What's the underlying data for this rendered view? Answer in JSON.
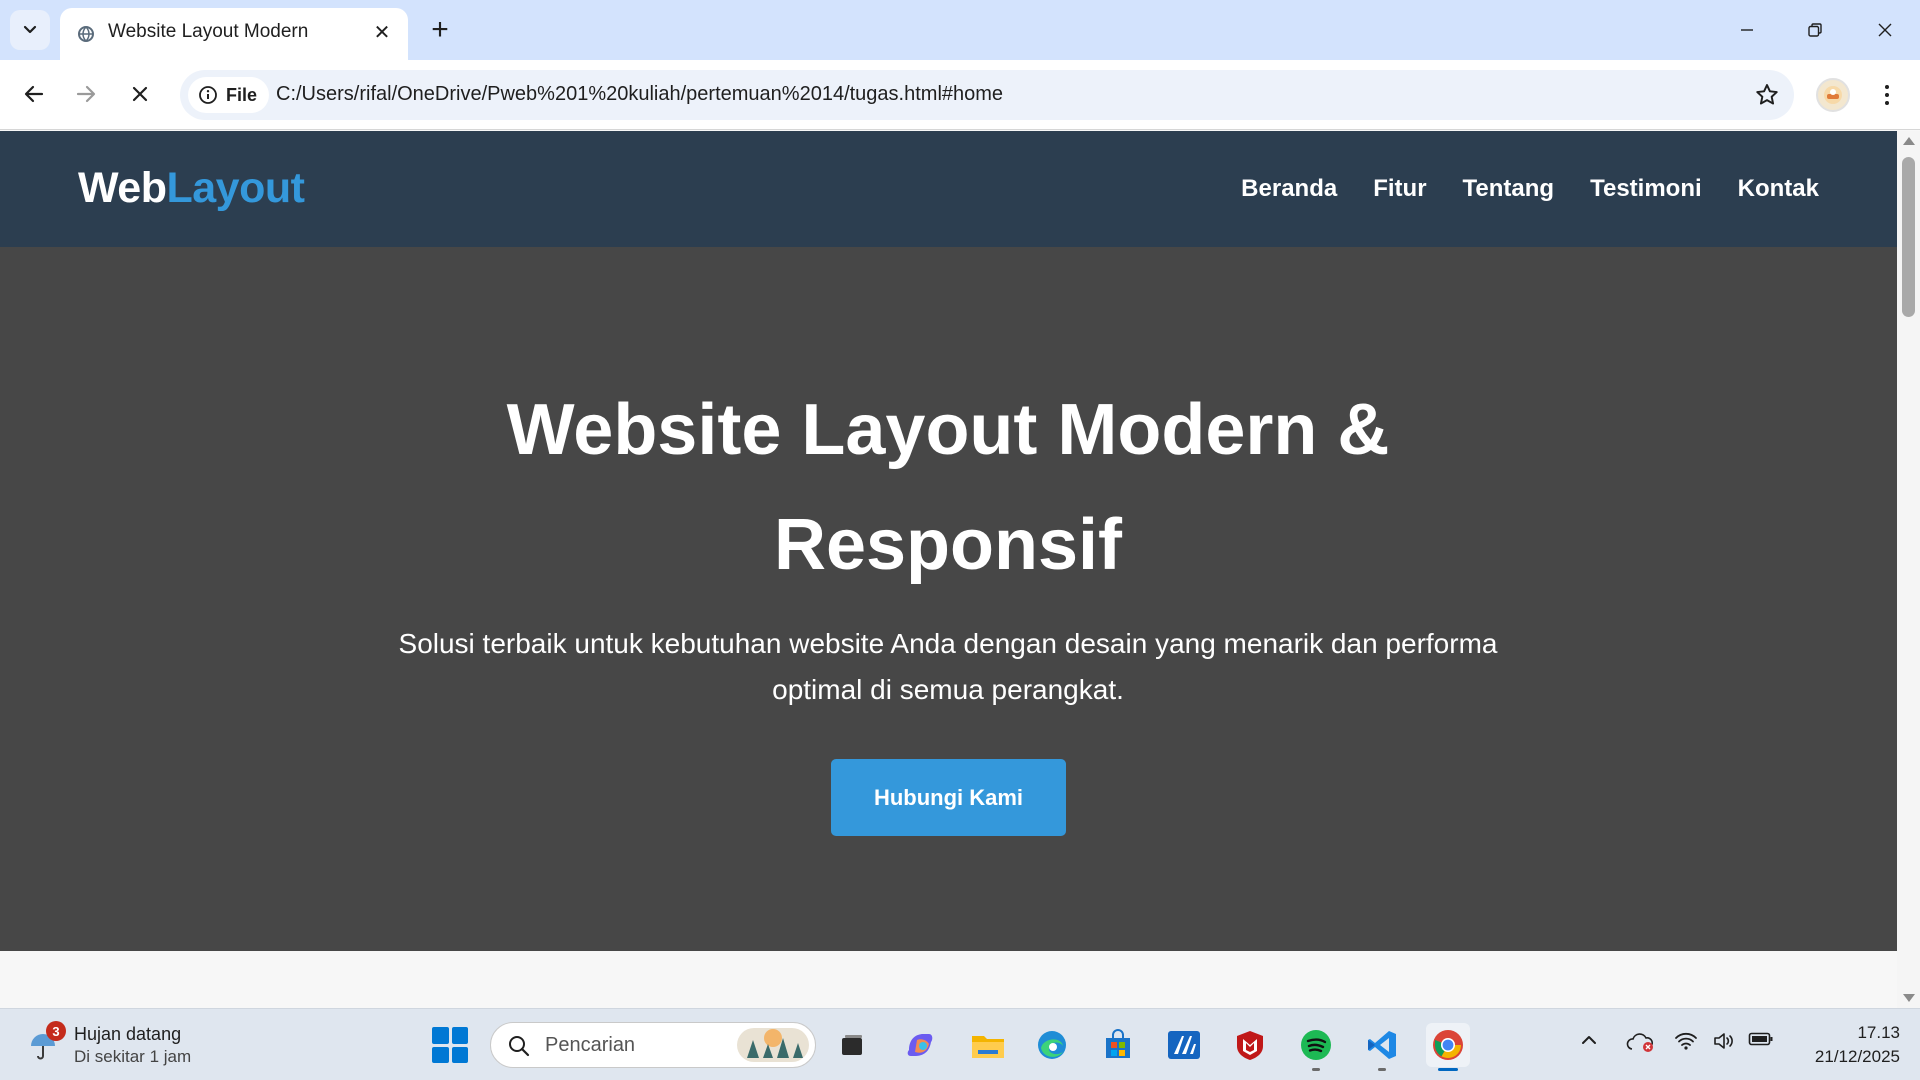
{
  "browser": {
    "tab_title": "Website Layout Modern",
    "new_tab_symbol": "+",
    "close_symbol": "✕",
    "file_chip_label": "File",
    "url": "C:/Users/rifal/OneDrive/Pweb%201%20kuliah/pertemuan%2014/tugas.html#home",
    "icons": [
      "tab-search-icon",
      "globe-icon",
      "back-icon",
      "forward-icon",
      "stop-loading-icon",
      "info-icon",
      "star-icon",
      "profile-avatar",
      "menu-icon",
      "minimize-icon",
      "restore-icon",
      "window-close-icon"
    ]
  },
  "site": {
    "logo_part1": "Web",
    "logo_part2": "Layout",
    "nav": [
      "Beranda",
      "Fitur",
      "Tentang",
      "Testimoni",
      "Kontak"
    ],
    "hero_title": "Website Layout Modern & Responsif",
    "hero_description": "Solusi terbaik untuk kebutuhan website Anda dengan desain yang menarik dan performa optimal di semua perangkat.",
    "hero_button": "Hubungi Kami",
    "colors": {
      "header_bg": "#2c3e50",
      "accent": "#3498db",
      "hero_bg": "#474747"
    }
  },
  "taskbar": {
    "weather_badge": "3",
    "weather_title": "Hujan datang",
    "weather_subtitle": "Di sekitar 1 jam",
    "search_placeholder": "Pencarian",
    "apps": [
      "start-icon",
      "task-view-icon",
      "copilot-icon",
      "file-explorer-icon",
      "edge-icon",
      "ms-store-icon",
      "vscode-alt-icon",
      "mcafee-icon",
      "spotify-icon",
      "vscode-icon",
      "chrome-icon"
    ],
    "tray_icons": [
      "chevron-up-icon",
      "onedrive-error-icon",
      "wifi-icon",
      "volume-icon",
      "battery-icon"
    ],
    "time": "17.13",
    "date": "21/12/2025"
  }
}
